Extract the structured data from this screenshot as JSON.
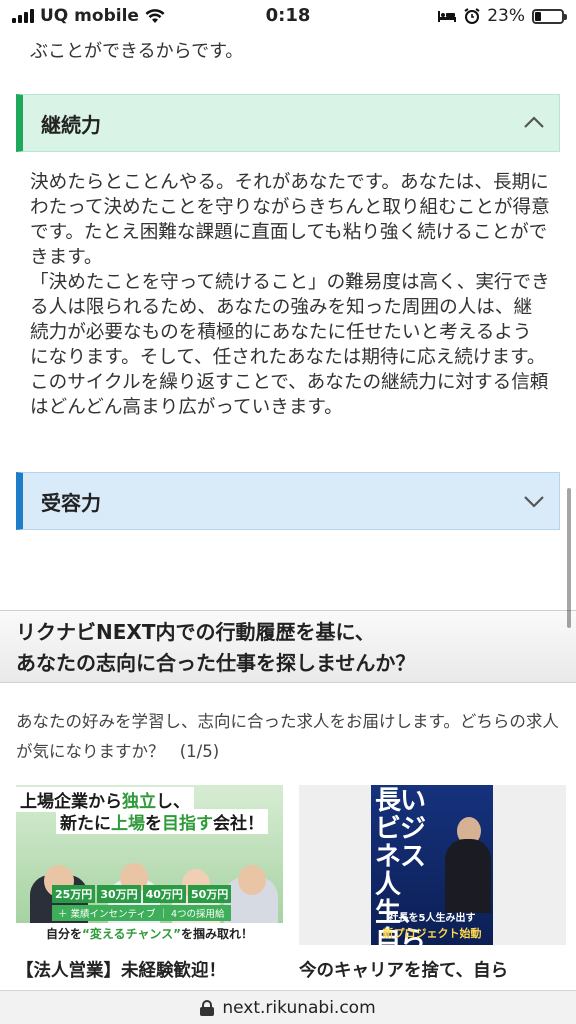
{
  "status_bar": {
    "carrier": "UQ mobile",
    "time": "0:18",
    "battery": "23%",
    "battery_level": 0.23
  },
  "article": {
    "cut_text_line": "ぶことができるからです。",
    "open_section": {
      "title": "継続力",
      "paragraphs": [
        "決めたらとことんやる。それがあなたです。あなたは、長期にわたって決めたことを守りながらきちんと取り組むことが得意です。たとえ困難な課題に直面しても粘り強く続けることができます。",
        "「決めたことを守って続けること」の難易度は高く、実行できる人は限られるため、あなたの強みを知った周囲の人は、継続力が必要なものを積極的にあなたに任せたいと考えるようになります。そして、任されたあなたは期待に応え続けます。このサイクルを繰り返すことで、あなたの継続力に対する信頼はどんどん高まり広がっていきます。"
      ]
    },
    "closed_section": {
      "title": "受容力"
    }
  },
  "recommendation": {
    "heading_line1": "リクナビNEXT内での行動履歴を基に、",
    "heading_line2": "あなたの志向に合った仕事を探しませんか？",
    "description": "あなたの好みを学習し、志向に合った求人をお届けします。どちらの求人が気になりますか？",
    "counter": "(1/5)",
    "cards": [
      {
        "title": "【法人営業】未経験歓迎！",
        "image": {
          "headline1_a": "上場企業から",
          "headline1_b": "独立",
          "headline1_c": "し、",
          "headline2_a": "新たに",
          "headline2_b": "上場",
          "headline2_c": "を",
          "headline2_d": "目指す",
          "headline2_e": "会社！",
          "salaries": [
            "25万円",
            "30万円",
            "40万円",
            "50万円"
          ],
          "incentive": "＋ 業績インセンティブ ｜ 4つの採用給",
          "slogan_a": "自分を",
          "slogan_b": "“変えるチャンス”",
          "slogan_c": "を掴み取れ！"
        }
      },
      {
        "title": "今のキャリアを捨て、自ら",
        "image": {
          "headline": "長いビジネス人生、自ら切り拓け",
          "sub1": "社長を5人生み出す",
          "sub2": "新プロジェクト始動"
        }
      }
    ]
  },
  "url_bar": {
    "host": "next.rikunabi.com"
  },
  "colors": {
    "open_accent": "#1da85c",
    "open_bg": "#d9f4e6",
    "closed_accent": "#1f7dc8",
    "closed_bg": "#d9eaf9"
  }
}
